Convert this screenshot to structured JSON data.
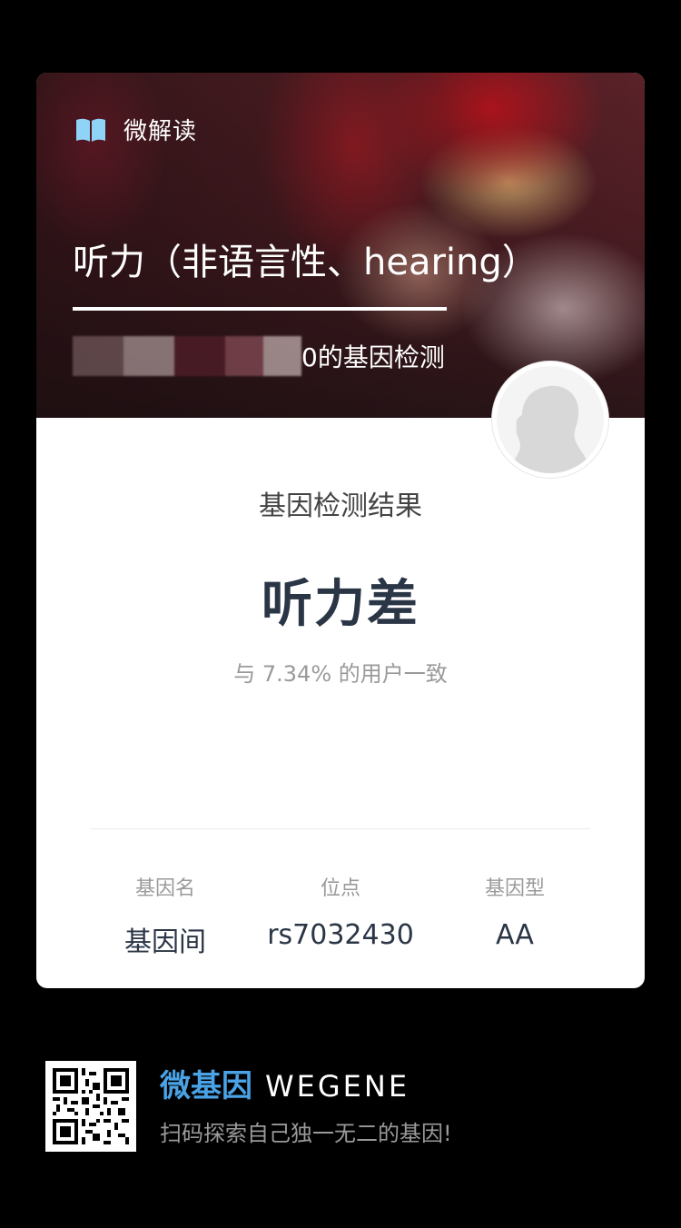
{
  "header": {
    "brand_label": "微解读",
    "title": "听力（非语言性、hearing）",
    "subtitle_suffix": "0的基因检测"
  },
  "result": {
    "label": "基因检测结果",
    "value": "听力差",
    "stat": "与 7.34% 的用户一致"
  },
  "details": {
    "gene_name": {
      "label": "基因名",
      "value": "基因间"
    },
    "locus": {
      "label": "位点",
      "value": "rs7032430"
    },
    "genotype": {
      "label": "基因型",
      "value": "AA"
    }
  },
  "footer": {
    "brand_cn": "微基因",
    "brand_en": "WEGENE",
    "slogan": "扫码探索自己独一无二的基因!"
  },
  "colors": {
    "page_bg": "#000000",
    "card_bg": "#ffffff",
    "brand_blue": "#4aa3e6",
    "result_text": "#2a3545",
    "muted_text": "#9a9a9a"
  },
  "icons": {
    "book": "open-book-icon",
    "avatar": "user-silhouette-avatar",
    "qr": "qr-code"
  }
}
